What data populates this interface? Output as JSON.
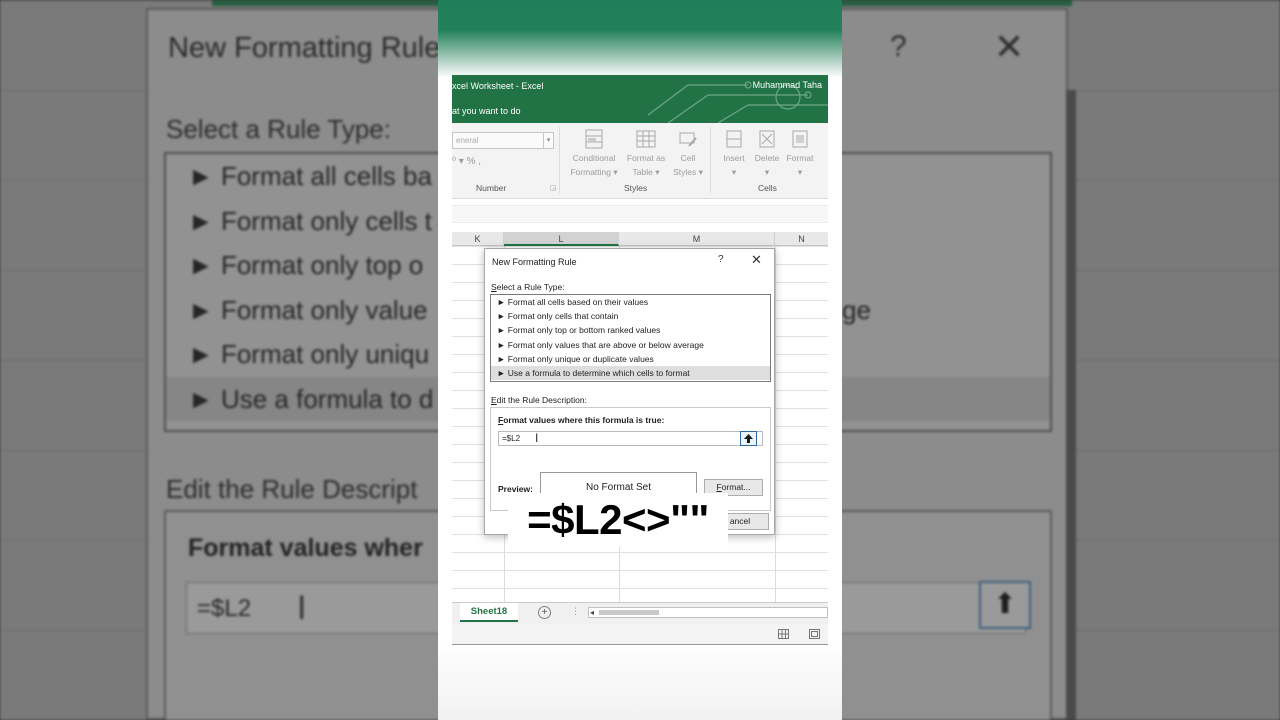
{
  "background": {
    "dialog_title": "New Formatting Rule",
    "help": "?",
    "close": "✕",
    "select_rule_label": "Select a Rule Type:",
    "rule_items": [
      "► Format all cells ba",
      "► Format only cells t",
      "► Format only top o",
      "► Format only value",
      "► Format only uniqu",
      "► Use a formula to d"
    ],
    "rule_overflow_fragment": "ge",
    "edit_label": "Edit the Rule Descript",
    "format_heading": "Format values wher",
    "formula_value": "=$L2",
    "cursor": "I",
    "collapse": "⬆"
  },
  "excel": {
    "title": "xcel Worksheet  -  Excel",
    "user": "Muhammad Taha",
    "tell_me": "at you want to do",
    "ribbon": {
      "number_format": "eneral",
      "number_tools": "⁰ ▾   %   ,",
      "groups": {
        "number": "Number",
        "styles": "Styles",
        "cells": "Cells"
      },
      "buttons": [
        {
          "line1": "Conditional",
          "line2": "Formatting ▾"
        },
        {
          "line1": "Format as",
          "line2": "Table ▾"
        },
        {
          "line1": "Cell",
          "line2": "Styles ▾"
        },
        {
          "line1": "Insert",
          "line2": "▾"
        },
        {
          "line1": "Delete",
          "line2": "▾"
        },
        {
          "line1": "Format",
          "line2": "▾"
        }
      ]
    },
    "columns": [
      "K",
      "L",
      "M",
      "N"
    ],
    "sheet_tab": "Sheet18",
    "add_sheet": "+",
    "tab_dots": "⋮",
    "dialog": {
      "title": "New Formatting Rule",
      "help": "?",
      "close": "✕",
      "select_label_first": "S",
      "select_label_rest": "elect a Rule Type:",
      "rule_types": [
        "► Format all cells based on their values",
        "► Format only cells that contain",
        "► Format only top or bottom ranked values",
        "► Format only values that are above or below average",
        "► Format only unique or duplicate values",
        "► Use a formula to determine which cells to format"
      ],
      "selected_rule_index": 5,
      "edit_label_first": "E",
      "edit_label_rest": "dit the Rule Description:",
      "formula_heading_first": "F",
      "formula_heading_rest": "ormat values where this formula is true:",
      "formula_value": "=$L2",
      "cursor": "I",
      "collapse": "⬆",
      "preview_label": "Preview:",
      "preview_text": "No Format Set",
      "format_button_first": "F",
      "format_button_rest": "ormat...",
      "cancel_button": "ancel"
    }
  },
  "caption": "=$L2<>\"\"",
  "colors": {
    "excel_green": "#217346",
    "accent_blue": "#2e6aa5"
  }
}
